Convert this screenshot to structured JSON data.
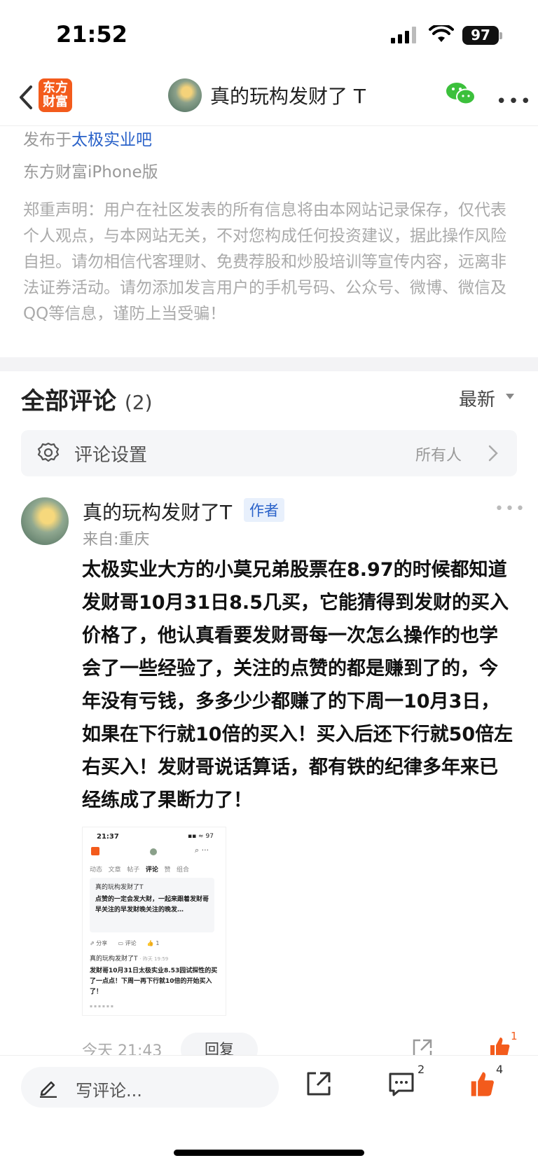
{
  "status": {
    "time": "21:52",
    "battery": "97"
  },
  "nav": {
    "logo_text": "东方财富",
    "title": "真的玩构发财了 T"
  },
  "post_meta": {
    "published_prefix": "发布于",
    "published_forum": "太极实业吧",
    "device": "东方财富iPhone版",
    "disclaimer": "郑重声明：用户在社区发表的所有信息将由本网站记录保存，仅代表个人观点，与本网站无关，不对您构成任何投资建议，据此操作风险自担。请勿相信代客理财、免费荐股和炒股培训等宣传内容，远离非法证券活动。请勿添加发言用户的手机号码、公众号、微博、微信及QQ等信息，谨防上当受骗！"
  },
  "comments_header": {
    "title": "全部评论",
    "count": "(2)",
    "sort": "最新"
  },
  "settings_row": {
    "label": "评论设置",
    "value": "所有人"
  },
  "comment": {
    "author": "真的玩构发财了T",
    "badge": "作者",
    "from": "来自:重庆",
    "body": "太极实业大方的小莫兄弟股票在8.97的时候都知道发财哥10月31日8.5几买，它能猜得到发财的买入价格了，他认真看要发财哥每一次怎么操作的也学会了一些经验了，关注的点赞的都是赚到了的，今年没有亏钱，多多少少都赚了的下周一10月3日，如果在下行就10倍的买入！买入后还下行就50倍左右买入！发财哥说话算话，都有铁的纪律多年来已经练成了果断力了！",
    "time": "今天 21:43",
    "reply_label": "回复",
    "like_count": "1",
    "image": {
      "time": "21:37",
      "battery": "97",
      "tabs": [
        "动态",
        "文章",
        "帖子",
        "评论",
        "赞",
        "组合"
      ],
      "active_tab": "评论",
      "card_name": "真的玩构发财了T",
      "card_text": "点赞的一定会发大财，一起来跟着发财哥早关注的早发财晚关注的晚发…",
      "actions": [
        "分享",
        "评论",
        "1"
      ],
      "post_name": "真的玩构发财了T",
      "post_time": "· 昨天 19:59",
      "post_text": "发财哥10月31日太极实业8.53园试探性的买了一点点！下周一再下行就10倍的开始买入了！"
    }
  },
  "bottom": {
    "placeholder": "写评论...",
    "comment_count": "2",
    "like_count": "4"
  },
  "colors": {
    "brand": "#f35b1c",
    "link": "#2a62c9",
    "wechat": "#3cc03c"
  }
}
